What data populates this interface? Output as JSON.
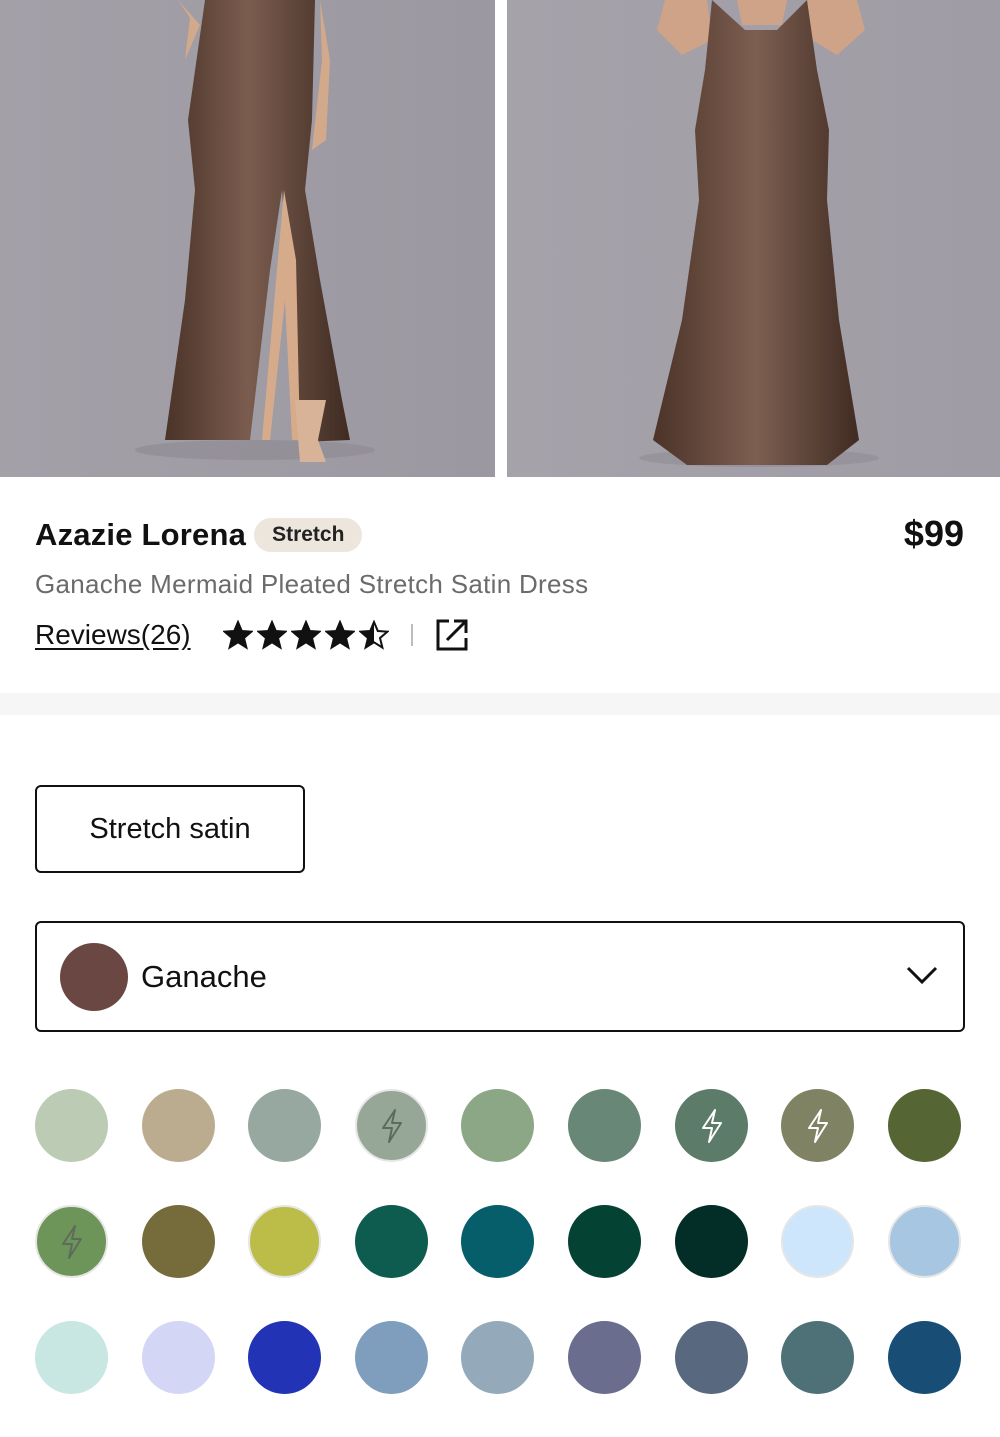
{
  "product": {
    "brand": "Azazie Lorena",
    "badge": "Stretch",
    "price": "$99",
    "subtitle": "Ganache Mermaid Pleated Stretch Satin Dress",
    "reviews_label": "Reviews(26)",
    "rating": 4.5,
    "rating_max": 5
  },
  "fabric": {
    "label": "Stretch satin"
  },
  "color_select": {
    "selected": "Ganache",
    "selected_color": "#6b4743"
  },
  "swatches": [
    [
      {
        "color": "#bccbb4",
        "bolt": false
      },
      {
        "color": "#bcac8f",
        "bolt": false
      },
      {
        "color": "#97a8a0",
        "bolt": false
      },
      {
        "color": "#96a797",
        "bolt": true,
        "light": true
      },
      {
        "color": "#8ba785",
        "bolt": false
      },
      {
        "color": "#688776",
        "bolt": false
      },
      {
        "color": "#5c7b69",
        "bolt": true
      },
      {
        "color": "#808363",
        "bolt": true
      },
      {
        "color": "#566534",
        "bolt": false
      }
    ],
    [
      {
        "color": "#6e9559",
        "bolt": true,
        "light": true
      },
      {
        "color": "#766b3b",
        "bolt": false
      },
      {
        "color": "#bcbc49",
        "bolt": false,
        "light": true
      },
      {
        "color": "#0e5c4f",
        "bolt": false
      },
      {
        "color": "#065e6b",
        "bolt": false
      },
      {
        "color": "#044234",
        "bolt": false
      },
      {
        "color": "#032e28",
        "bolt": false
      },
      {
        "color": "#cde6fb",
        "bolt": false,
        "light": true
      },
      {
        "color": "#a6c6e2",
        "bolt": false,
        "light": true
      }
    ],
    [
      {
        "color": "#c8e6e2",
        "bolt": false
      },
      {
        "color": "#d3d6f4",
        "bolt": false
      },
      {
        "color": "#2233b5",
        "bolt": false
      },
      {
        "color": "#7f9dbd",
        "bolt": false
      },
      {
        "color": "#94a9b9",
        "bolt": false
      },
      {
        "color": "#6a6d8d",
        "bolt": false
      },
      {
        "color": "#58687e",
        "bolt": false
      },
      {
        "color": "#4e7077",
        "bolt": false
      },
      {
        "color": "#184e75",
        "bolt": false
      }
    ]
  ]
}
